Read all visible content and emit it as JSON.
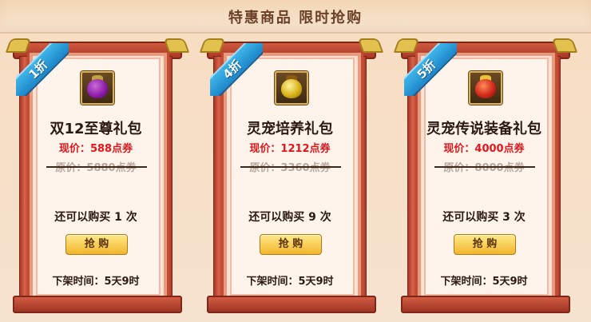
{
  "header": {
    "title": "特惠商品  限时抢购"
  },
  "labels": {
    "now_price_prefix": "现价：",
    "orig_price_prefix": "原价：",
    "remain_prefix": "还可以购买 ",
    "remain_suffix": " 次",
    "buy": "抢 购",
    "off_shelf_prefix": "下架时间："
  },
  "cards": [
    {
      "discount": "1折",
      "name": "双12至尊礼包",
      "now_price": "588点券",
      "orig_price": "5880点券",
      "remain": "1",
      "off_time": "5天9时",
      "icon": "purple-gift-bag-icon",
      "bag_color": "#8a1aa6"
    },
    {
      "discount": "4折",
      "name": "灵宠培养礼包",
      "now_price": "1212点券",
      "orig_price": "3360点券",
      "remain": "9",
      "off_time": "5天9时",
      "icon": "gold-pouch-icon",
      "bag_color": "#d9b318"
    },
    {
      "discount": "5折",
      "name": "灵宠传说装备礼包",
      "now_price": "4000点券",
      "orig_price": "8000点券",
      "remain": "3",
      "off_time": "5天9时",
      "icon": "red-gift-bag-icon",
      "bag_color": "#d42a1a"
    }
  ]
}
